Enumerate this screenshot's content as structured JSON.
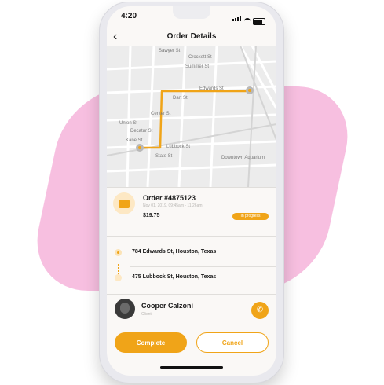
{
  "status_bar": {
    "time": "4:20"
  },
  "header": {
    "back_icon": "chevron-left-icon",
    "title": "Order Details"
  },
  "map": {
    "streets": {
      "crockett": "Crockett St",
      "summer": "Summer St",
      "sawyer": "Sawyer St",
      "edwards": "Edwards St",
      "dart": "Dart St",
      "center": "Center St",
      "union": "Union St",
      "decatur": "Decatur St",
      "kane": "Kane St",
      "lubbock": "Lubbock St",
      "state": "State St",
      "downtown_aquarium": "Downtown Aquarium"
    },
    "route_color": "#f0a418"
  },
  "order": {
    "icon": "package-icon",
    "title": "Order #4875123",
    "datetime": "Nov 01, 2019, 09:45am - 11:26am",
    "price": "$19.75",
    "status": "In progress"
  },
  "addresses": {
    "pickup": "784 Edwards St, Houston, Texas",
    "dropoff": "475 Lubbock St, Houston, Texas"
  },
  "client": {
    "name": "Cooper Calzoni",
    "role": "Client",
    "call_icon": "phone-icon"
  },
  "actions": {
    "complete_label": "Complete",
    "cancel_label": "Cancel"
  },
  "colors": {
    "accent": "#f0a418",
    "background_shape": "#f7bfe0"
  }
}
